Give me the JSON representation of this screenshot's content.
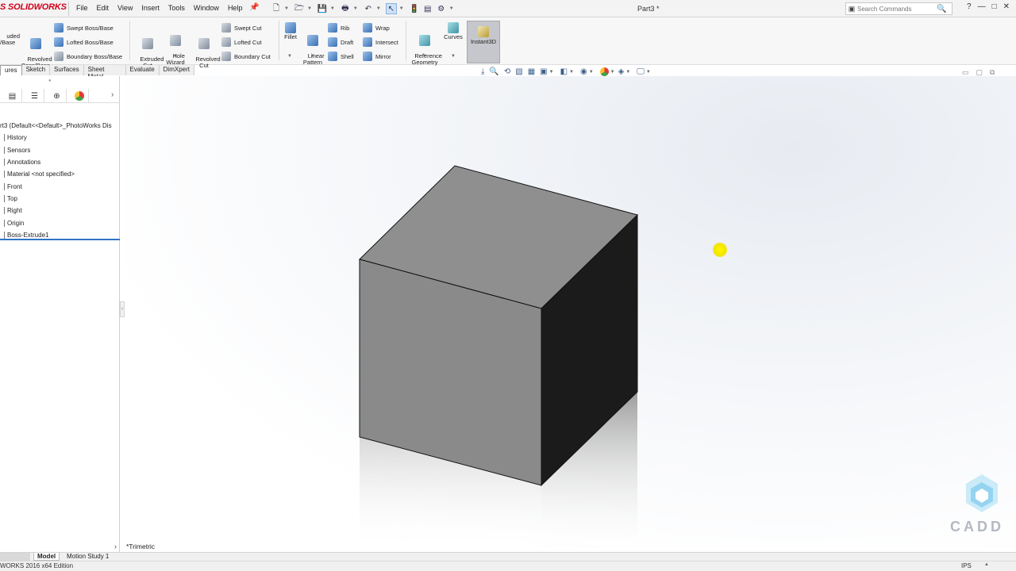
{
  "app": {
    "logo_text": "S SOLIDWORKS",
    "document_title": "Part3 *",
    "brand_color": "#d0021b"
  },
  "menu": [
    "File",
    "Edit",
    "View",
    "Insert",
    "Tools",
    "Window",
    "Help"
  ],
  "search": {
    "placeholder": "Search Commands"
  },
  "window_controls": {
    "help": "?",
    "minimize": "—",
    "restore": "□",
    "close": "✕"
  },
  "toolbar": {
    "extruded_boss": "uded\n/Base",
    "revolved_boss": "Revolved\nBoss/Base",
    "swept_boss": "Swept Boss/Base",
    "lofted_boss": "Lofted Boss/Base",
    "boundary_boss": "Boundary Boss/Base",
    "extruded_cut": "Extruded\nCut",
    "hole_wizard": "Hole\nWizard",
    "revolved_cut": "Revolved\nCut",
    "swept_cut": "Swept Cut",
    "lofted_cut": "Lofted Cut",
    "boundary_cut": "Boundary Cut",
    "fillet": "Fillet",
    "linear_pattern": "Linear\nPattern",
    "rib": "Rib",
    "draft": "Draft",
    "shell": "Shell",
    "wrap": "Wrap",
    "intersect": "Intersect",
    "mirror": "Mirror",
    "reference_geometry": "Reference\nGeometry",
    "curves": "Curves",
    "instant3d": "Instant3D"
  },
  "command_tabs": [
    {
      "label": "ures",
      "active": true
    },
    {
      "label": "Sketch",
      "active": false
    },
    {
      "label": "Surfaces",
      "active": false
    },
    {
      "label": "Sheet Metal",
      "active": false
    },
    {
      "label": "Evaluate",
      "active": false
    },
    {
      "label": "DimXpert",
      "active": false
    }
  ],
  "feature_tree": {
    "root": "rt3  (Default<<Default>_PhotoWorks Dis",
    "items": [
      "History",
      "Sensors",
      "Annotations",
      "Material <not specified>",
      "Front",
      "Top",
      "Right",
      "Origin",
      "Boss-Extrude1"
    ]
  },
  "viewport": {
    "view_name": "*Trimetric",
    "cadd_text": "CADD"
  },
  "bottom_tabs": {
    "model": "Model",
    "motion": "Motion Study 1"
  },
  "status": {
    "edition": "WORKS 2016 x64 Edition",
    "units": "IPS"
  }
}
